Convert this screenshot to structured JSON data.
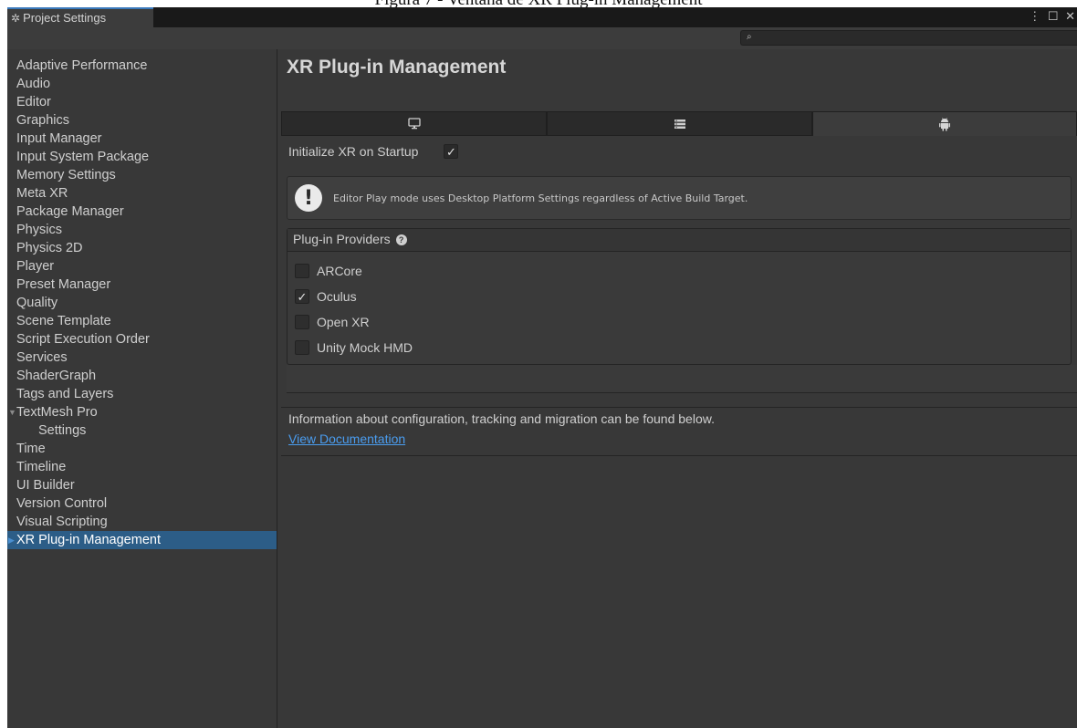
{
  "caption": "Figura 7 - Ventana de XR Plug-in Management",
  "window": {
    "tab_title": "Project Settings",
    "controls": "⋮ ☐ ✕"
  },
  "sidebar": {
    "items": [
      {
        "label": "Adaptive Performance"
      },
      {
        "label": "Audio"
      },
      {
        "label": "Editor"
      },
      {
        "label": "Graphics"
      },
      {
        "label": "Input Manager"
      },
      {
        "label": "Input System Package"
      },
      {
        "label": "Memory Settings"
      },
      {
        "label": "Meta XR"
      },
      {
        "label": "Package Manager"
      },
      {
        "label": "Physics"
      },
      {
        "label": "Physics 2D"
      },
      {
        "label": "Player"
      },
      {
        "label": "Preset Manager"
      },
      {
        "label": "Quality"
      },
      {
        "label": "Scene Template"
      },
      {
        "label": "Script Execution Order"
      },
      {
        "label": "Services"
      },
      {
        "label": "ShaderGraph"
      },
      {
        "label": "Tags and Layers"
      },
      {
        "label": "TextMesh Pro"
      },
      {
        "label": "Settings"
      },
      {
        "label": "Time"
      },
      {
        "label": "Timeline"
      },
      {
        "label": "UI Builder"
      },
      {
        "label": "Version Control"
      },
      {
        "label": "Visual Scripting"
      },
      {
        "label": "XR Plug-in Management"
      }
    ],
    "selected": "XR Plug-in Management"
  },
  "main": {
    "title": "XR Plug-in Management",
    "platform_tabs": [
      {
        "icon": "desktop-icon"
      },
      {
        "icon": "server-icon"
      },
      {
        "icon": "android-icon",
        "active": true
      }
    ],
    "init_label": "Initialize XR on Startup",
    "init_checked": true,
    "help_text": "Editor Play mode uses Desktop Platform Settings regardless of Active Build Target.",
    "providers": {
      "header": "Plug-in Providers",
      "items": [
        {
          "label": "ARCore",
          "checked": false
        },
        {
          "label": "Oculus",
          "checked": true
        },
        {
          "label": "Open XR",
          "checked": false
        },
        {
          "label": "Unity Mock HMD",
          "checked": false
        }
      ]
    },
    "info_text": "Information about configuration, tracking and migration can be found below.",
    "doc_link": "View Documentation"
  },
  "colors": {
    "background": "#383838",
    "tab_bar": "#191919",
    "selection": "#2c5d87",
    "link": "#4a9df0",
    "accent": "#3a79bb"
  },
  "check_mark": "✓"
}
